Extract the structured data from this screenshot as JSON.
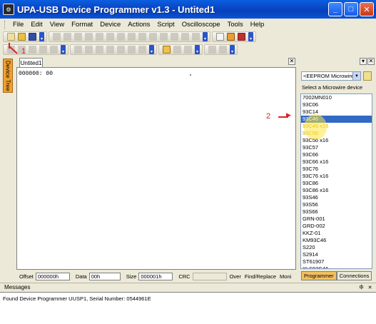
{
  "window": {
    "title": "UPA-USB Device Programmer v1.3 - Untited1"
  },
  "window_buttons": {
    "minimize": "_",
    "maximize": "□",
    "close": "✕"
  },
  "menu": [
    "File",
    "Edit",
    "View",
    "Format",
    "Device",
    "Actions",
    "Script",
    "Oscilloscope",
    "Tools",
    "Help"
  ],
  "left_tab": {
    "label": "Device Tree"
  },
  "document": {
    "tab": "Untited1",
    "content": "000000:  00"
  },
  "doc_controls": {
    "close": "✕"
  },
  "right_panel": {
    "selector_value": "<EEPROM Microwire",
    "caption": "Select a Microwire device",
    "devices": [
      {
        "label": "7002MN010",
        "color": "#000000"
      },
      {
        "label": "93C06",
        "color": "#000000"
      },
      {
        "label": "93C14",
        "color": "#000000"
      },
      {
        "label": "93C46",
        "color": "#ffffff"
      },
      {
        "label": "93C46 x16",
        "color": "#d8a800"
      },
      {
        "label": "93C56",
        "color": "#d8a800"
      },
      {
        "label": "93C56 x16",
        "color": "#000000"
      },
      {
        "label": "93C57",
        "color": "#000000"
      },
      {
        "label": "93C66",
        "color": "#000000"
      },
      {
        "label": "93C66 x16",
        "color": "#000000"
      },
      {
        "label": "93C76",
        "color": "#000000"
      },
      {
        "label": "93C76 x16",
        "color": "#000000"
      },
      {
        "label": "93C86",
        "color": "#000000"
      },
      {
        "label": "93C86 x16",
        "color": "#000000"
      },
      {
        "label": "93S46",
        "color": "#000000"
      },
      {
        "label": "93S56",
        "color": "#000000"
      },
      {
        "label": "93S66",
        "color": "#000000"
      },
      {
        "label": "GRN-001",
        "color": "#000000"
      },
      {
        "label": "GRD-002",
        "color": "#000000"
      },
      {
        "label": "KKZ-01",
        "color": "#000000"
      },
      {
        "label": "KM93C46",
        "color": "#000000"
      },
      {
        "label": "S220",
        "color": "#000000"
      },
      {
        "label": "S2914",
        "color": "#000000"
      },
      {
        "label": "ST61907",
        "color": "#000000"
      },
      {
        "label": "XLS93C46",
        "color": "#000000"
      }
    ],
    "selected_index": 3,
    "tabs": [
      "Programmer",
      "Connections"
    ]
  },
  "status": {
    "offset_label": "Offset",
    "offset_value": "000000h",
    "data_label": "Data",
    "data_value": "00h",
    "size_label": "Size",
    "size_value": "000001h",
    "crc_label": "CRC",
    "over": "Over",
    "find_replace": "Find/Replace",
    "moni": "Moni"
  },
  "messages": {
    "title": "Messages",
    "line": "Found Device Programmer UUSP1, Serial Number: 0544961E",
    "pin": "ф",
    "close": "✕"
  },
  "annotations": {
    "a1": "1",
    "a2": "2"
  },
  "colors": {
    "titlebar": "#0a48c8",
    "selection": "#316ac5",
    "annotation": "#e02020",
    "accent_tab": "#f4c060"
  }
}
